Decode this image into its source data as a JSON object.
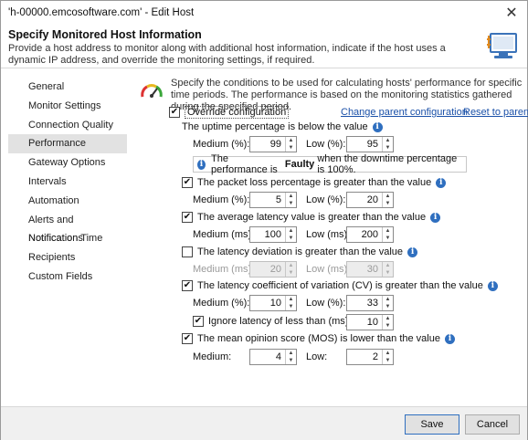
{
  "window": {
    "title": "'h-00000.emcosoftware.com' - Edit Host",
    "close_glyph": "✕"
  },
  "header": {
    "title": "Specify Monitored Host Information",
    "description": "Provide a host address to monitor along with additional host information, indicate if the host uses a dynamic IP address, and override the monitoring settings, if required."
  },
  "sidebar": {
    "items": [
      {
        "label": "General"
      },
      {
        "label": "Monitor Settings"
      },
      {
        "label": "Connection Quality"
      },
      {
        "label": "Performance",
        "active": true
      },
      {
        "label": "Gateway Options"
      },
      {
        "label": "Intervals"
      },
      {
        "label": "Automation"
      },
      {
        "label": "Alerts and Notifications"
      },
      {
        "label": "Notification Time"
      },
      {
        "label": "Recipients"
      },
      {
        "label": "Custom Fields"
      }
    ]
  },
  "content": {
    "intro": "Specify the conditions to be used for calculating hosts' performance for specific time periods. The performance is based on the monitoring statistics gathered during the specified period.",
    "override_label": "Override configuration",
    "change_parent_link": "Change parent configuration",
    "reset_parent_link": "Reset to parent",
    "uptime": {
      "label": "The uptime percentage is below the value",
      "medium_label": "Medium (%):",
      "medium_value": "99",
      "low_label": "Low (%):",
      "low_value": "95",
      "note_prefix": "The performance is",
      "note_bold": "Faulty",
      "note_suffix": "when the downtime percentage is 100%."
    },
    "packet_loss": {
      "label": "The packet loss percentage is greater than the value",
      "medium_label": "Medium (%):",
      "medium_value": "5",
      "low_label": "Low (%):",
      "low_value": "20"
    },
    "avg_latency": {
      "label": "The average latency value is greater than the value",
      "medium_label": "Medium (ms):",
      "medium_value": "100",
      "low_label": "Low (ms):",
      "low_value": "200"
    },
    "latency_dev": {
      "label": "The latency deviation is greater than the value",
      "medium_label": "Medium (ms):",
      "medium_value": "20",
      "low_label": "Low (ms):",
      "low_value": "30"
    },
    "latency_cv": {
      "label": "The latency coefficient of variation (CV) is greater than the value",
      "medium_label": "Medium (%):",
      "medium_value": "10",
      "low_label": "Low (%):",
      "low_value": "33",
      "ignore_label": "Ignore latency of less than (ms):",
      "ignore_value": "10"
    },
    "mos": {
      "label": "The mean opinion score (MOS) is lower than the value",
      "medium_label": "Medium:",
      "medium_value": "4",
      "low_label": "Low:",
      "low_value": "2"
    }
  },
  "footer": {
    "save_label": "Save",
    "cancel_label": "Cancel"
  }
}
